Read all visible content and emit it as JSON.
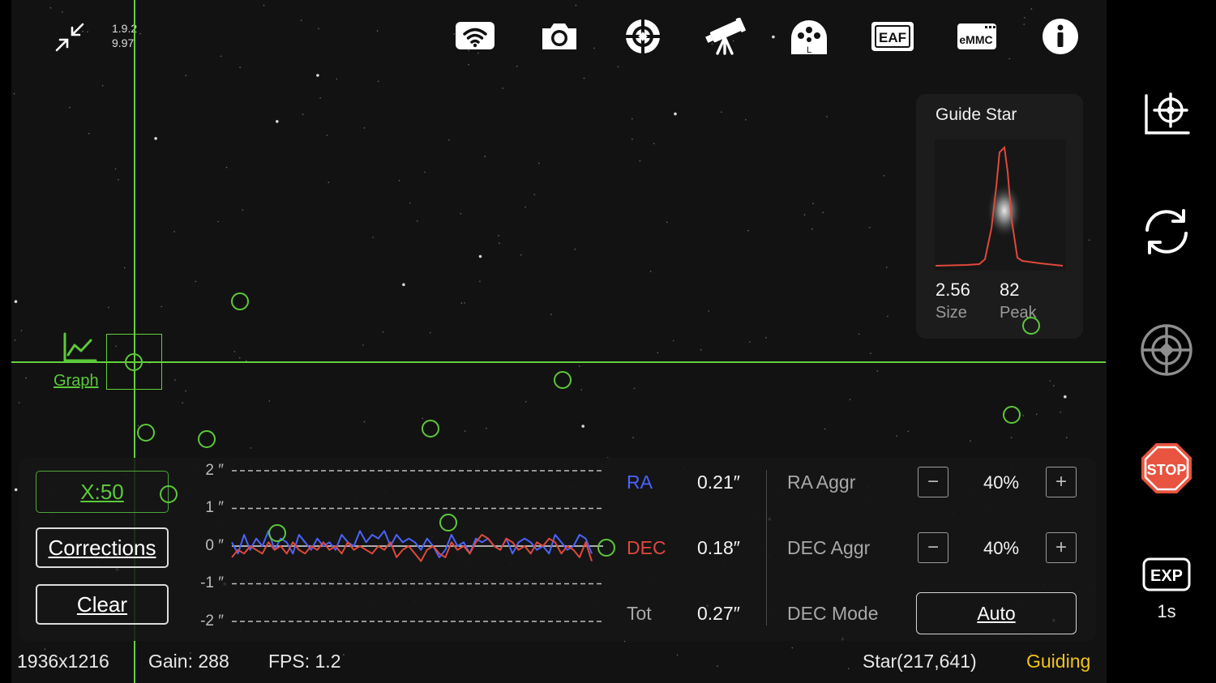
{
  "header": {
    "version_line1": "1.9.2",
    "version_line2": "9.97",
    "icons": [
      "wifi-icon",
      "camera-icon",
      "guide-target-icon",
      "telescope-icon",
      "filter-wheel-icon",
      "eaf-icon",
      "emmc-icon",
      "info-icon"
    ],
    "eaf_label": "EAF",
    "emmc_label": "eMMC",
    "filter_label": "L"
  },
  "graph_link": {
    "label": "Graph"
  },
  "guide_star": {
    "title": "Guide Star",
    "size_value": "2.56",
    "size_label": "Size",
    "peak_value": "82",
    "peak_label": "Peak"
  },
  "guide_panel": {
    "x_scale_label": "X:50",
    "corrections_label": "Corrections",
    "clear_label": "Clear",
    "y_axis_labels": [
      "2 ″",
      "1 ″",
      "0 ″",
      "-1 ″",
      "-2 ″"
    ],
    "ra_label": "RA",
    "ra_value": "0.21″",
    "dec_label": "DEC",
    "dec_value": "0.18″",
    "tot_label": "Tot",
    "tot_value": "0.27″",
    "ra_aggr_label": "RA Aggr",
    "ra_aggr_value": "40%",
    "dec_aggr_label": "DEC Aggr",
    "dec_aggr_value": "40%",
    "dec_mode_label": "DEC Mode",
    "dec_mode_value": "Auto"
  },
  "status_bar": {
    "resolution": "1936x1216",
    "gain": "Gain: 288",
    "fps": "FPS: 1.2",
    "star": "Star(217,641)",
    "state": "Guiding"
  },
  "sidebar": {
    "icons": [
      "calibrate-target-icon",
      "refresh-icon",
      "guide-reticle-icon",
      "stop-icon",
      "exposure-icon"
    ],
    "stop_label": "STOP",
    "exp_label": "EXP",
    "exposure_value": "1s"
  },
  "colors": {
    "accent_green": "#5bc83a",
    "ra_blue": "#4a63ff",
    "dec_red": "#e0483a",
    "guiding_yellow": "#f0c419",
    "stop_red": "#e8543f"
  },
  "chart_data": {
    "type": "line",
    "ylim": [
      -2,
      2
    ],
    "y_ticks": [
      2,
      1,
      0,
      -1,
      -2
    ],
    "series": [
      {
        "name": "RA",
        "color": "#4a63ff",
        "values": [
          0.1,
          -0.2,
          0.3,
          -0.1,
          0.2,
          0.0,
          0.4,
          -0.1,
          0.2,
          0.1,
          -0.2,
          0.3,
          0.1,
          -0.1,
          0.2,
          0.0,
          0.1,
          -0.1,
          0.3,
          0.1,
          0.0,
          0.4,
          0.1,
          0.3,
          0.2,
          0.4,
          0.0,
          0.3,
          0.1,
          0.2,
          0.1,
          -0.1,
          0.2,
          0.0,
          -0.3,
          -0.1,
          0.3,
          0.0,
          0.1,
          -0.2,
          0.2,
          0.1,
          0.2,
          0.0,
          -0.1,
          0.2,
          -0.2,
          0.1,
          0.2,
          0.1,
          -0.1,
          0.0,
          -0.2,
          0.3,
          0.1,
          -0.1,
          0.0,
          0.3,
          0.2,
          -0.2
        ]
      },
      {
        "name": "DEC",
        "color": "#e0483a",
        "values": [
          -0.3,
          -0.1,
          -0.2,
          0.0,
          -0.1,
          -0.2,
          0.1,
          -0.1,
          0.0,
          -0.2,
          0.1,
          -0.1,
          -0.2,
          0.0,
          -0.1,
          0.1,
          -0.1,
          0.0,
          -0.2,
          0.1,
          -0.1,
          0.0,
          -0.1,
          -0.2,
          0.0,
          -0.1,
          0.1,
          -0.3,
          -0.1,
          0.0,
          -0.2,
          -0.4,
          -0.1,
          0.0,
          -0.2,
          -0.3,
          0.1,
          -0.1,
          0.0,
          -0.2,
          0.1,
          0.3,
          0.2,
          0.0,
          -0.1,
          0.2,
          0.1,
          -0.1,
          0.0,
          -0.2,
          0.1,
          0.0,
          0.2,
          0.1,
          -0.2,
          0.0,
          -0.1,
          -0.3,
          0.1,
          -0.4
        ]
      }
    ]
  }
}
